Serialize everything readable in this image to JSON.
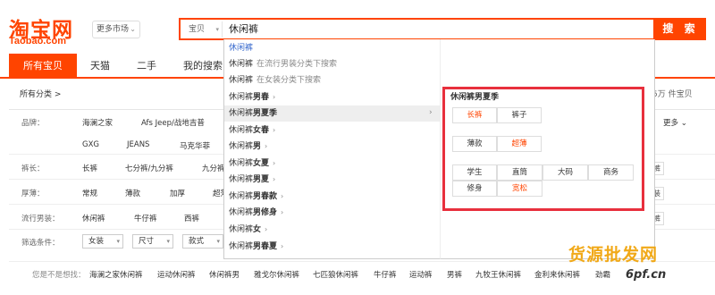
{
  "header": {
    "logo_cn": "淘宝网",
    "logo_en": "Taobao.com",
    "market_label": "更多市场",
    "search_category": "宝贝",
    "search_value": "休闲裤",
    "search_button": "搜 索"
  },
  "tabs": [
    "所有宝贝",
    "天猫",
    "二手",
    "我的搜索"
  ],
  "breadcrumb": "所有分类 >",
  "result_count": "5万 件宝贝",
  "attributes": {
    "brand_label": "品牌：",
    "brand_values_row1": [
      "海澜之家",
      "Afs Jeep/战地吉普"
    ],
    "brand_values_row2": [
      "GXG",
      "JEANS",
      "马克华菲"
    ],
    "more_label": "更多",
    "length_label": "裤长：",
    "length_values": [
      "长裤",
      "七分裤/九分裤",
      "九分裤"
    ],
    "thickness_label": "厚薄：",
    "thickness_values": [
      "常规",
      "薄款",
      "加厚",
      "超薄"
    ],
    "popular_label": "流行男装：",
    "popular_values": [
      "休闲裤",
      "牛仔裤",
      "西裤"
    ],
    "filter_label": "筛选条件：",
    "filter_dropdowns": [
      "女装",
      "尺寸",
      "款式"
    ]
  },
  "side_tags": [
    "裤",
    "装",
    "裤"
  ],
  "related": {
    "label": "您是不是想找：",
    "items": [
      "海澜之家休闲裤",
      "运动休闲裤",
      "休闲裤男",
      "雅戈尔休闲裤",
      "七匹狼休闲裤",
      "牛仔裤",
      "运动裤",
      "男裤",
      "九牧王休闲裤",
      "金利来休闲裤",
      "劲霸"
    ]
  },
  "suggestions": [
    {
      "text": "休闲裤",
      "bold": "",
      "hint": "",
      "arrow": false
    },
    {
      "text": "休闲裤",
      "bold": "",
      "hint": "在流行男装分类下搜索",
      "arrow": false
    },
    {
      "text": "休闲裤",
      "bold": "",
      "hint": "在女装分类下搜索",
      "arrow": false
    },
    {
      "text": "休闲裤",
      "bold": "男春",
      "hint": "",
      "arrow": true
    },
    {
      "text": "休闲裤",
      "bold": "男夏季",
      "hint": "",
      "arrow": false
    },
    {
      "text": "休闲裤",
      "bold": "女春",
      "hint": "",
      "arrow": true
    },
    {
      "text": "休闲裤",
      "bold": "男",
      "hint": "",
      "arrow": true
    },
    {
      "text": "休闲裤",
      "bold": "女夏",
      "hint": "",
      "arrow": true
    },
    {
      "text": "休闲裤",
      "bold": "男夏",
      "hint": "",
      "arrow": true
    },
    {
      "text": "休闲裤",
      "bold": "男春款",
      "hint": "",
      "arrow": true
    },
    {
      "text": "休闲裤",
      "bold": "男修身",
      "hint": "",
      "arrow": true
    },
    {
      "text": "休闲裤",
      "bold": "女",
      "hint": "",
      "arrow": true
    },
    {
      "text": "休闲裤",
      "bold": "男春夏",
      "hint": "",
      "arrow": true
    }
  ],
  "facet": {
    "title": "休闲裤男夏季",
    "group1": [
      "长裤",
      "裤子"
    ],
    "group2": [
      "薄款",
      "超薄"
    ],
    "group3": [
      "学生",
      "直筒",
      "大码",
      "商务",
      "修身",
      "宽松"
    ],
    "highlight_color": "#ff4400",
    "frame_color": "#e8303d"
  },
  "watermark": {
    "line1": "货源批发网",
    "line2": "6pf.cn"
  },
  "colors": {
    "brand": "#ff4400"
  }
}
